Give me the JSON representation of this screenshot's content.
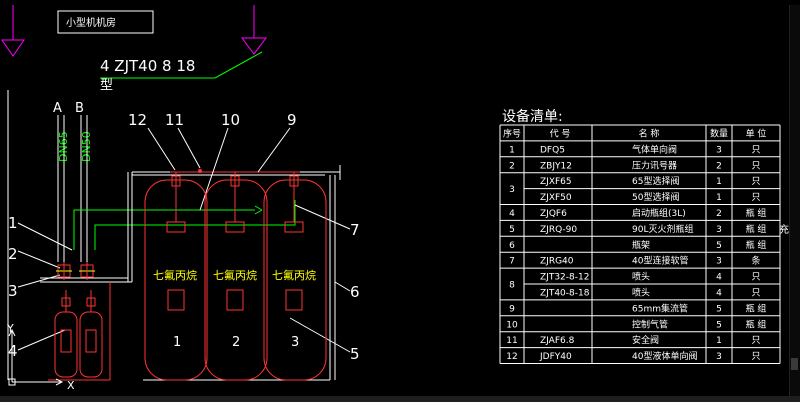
{
  "drawing": {
    "room_label": "小型机机房",
    "note_line1": "4 ZJT40 8 18",
    "note_line2": "型",
    "pipe_a": "A",
    "pipe_b": "B",
    "pipe_a_size": "DN65",
    "pipe_b_size": "DN50",
    "callouts": [
      "1",
      "2",
      "3",
      "4",
      "5",
      "6",
      "7",
      "9",
      "10",
      "11",
      "12"
    ],
    "cylinder_label": "七氟丙烷",
    "cylinder_numbers": [
      "1",
      "2",
      "3"
    ],
    "axis_x": "X",
    "axis_y": "Y"
  },
  "table": {
    "title": "设备清单:",
    "headers": [
      "序号",
      "代  号",
      "名  称",
      "数量",
      "单  位"
    ],
    "rows": [
      {
        "no": "1",
        "code": "DFQ5",
        "name": "气体单向阀",
        "qty": "3",
        "unit": "只"
      },
      {
        "no": "2",
        "code": "ZBJY12",
        "name": "压力讯号器",
        "qty": "2",
        "unit": "只"
      },
      {
        "no": "3",
        "code": "ZJXF65",
        "name": "65型选择阀",
        "qty": "1",
        "unit": "只"
      },
      {
        "no": "",
        "code": "ZJXF50",
        "name": "50型选择阀",
        "qty": "1",
        "unit": "只"
      },
      {
        "no": "4",
        "code": "ZJQF6",
        "name": "启动瓶组(3L)",
        "qty": "2",
        "unit": "瓶 组"
      },
      {
        "no": "5",
        "code": "ZJRQ-90",
        "name": "90L灭火剂瓶组",
        "qty": "3",
        "unit": "瓶 组"
      },
      {
        "no": "6",
        "code": "",
        "name": "瓶架",
        "qty": "5",
        "unit": "瓶 组"
      },
      {
        "no": "7",
        "code": "ZJRG40",
        "name": "40型连接软管",
        "qty": "3",
        "unit": "条"
      },
      {
        "no": "8",
        "code": "ZJT32-8-12",
        "name": "喷头",
        "qty": "4",
        "unit": "只"
      },
      {
        "no": "",
        "code": "ZJT40-8-18",
        "name": "喷头",
        "qty": "4",
        "unit": "只"
      },
      {
        "no": "9",
        "code": "",
        "name": "65mm集流管",
        "qty": "5",
        "unit": "瓶 组"
      },
      {
        "no": "10",
        "code": "",
        "name": "控制气管",
        "qty": "5",
        "unit": "瓶 组"
      },
      {
        "no": "11",
        "code": "ZJAF6.8",
        "name": "安全阀",
        "qty": "1",
        "unit": "只"
      },
      {
        "no": "12",
        "code": "JDFY40",
        "name": "40型液体单向阀",
        "qty": "3",
        "unit": "只"
      }
    ],
    "overflow_text": "充"
  }
}
